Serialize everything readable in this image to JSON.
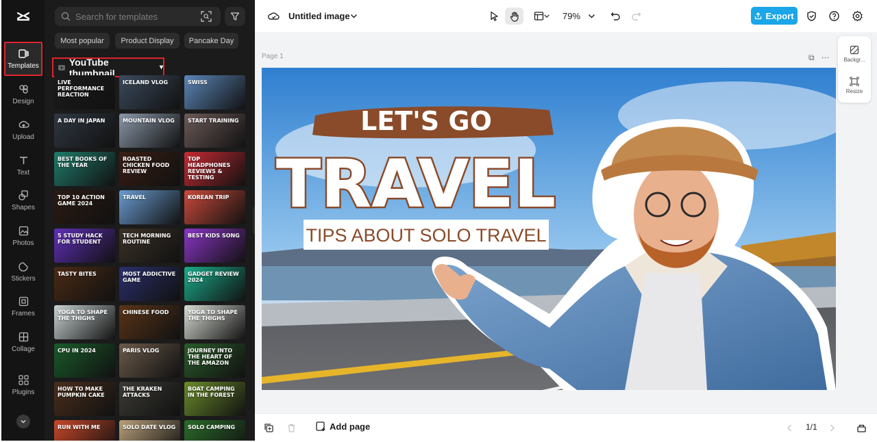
{
  "sidebar": {
    "items": [
      {
        "label": "Templates",
        "icon": "template-icon"
      },
      {
        "label": "Design",
        "icon": "design-icon"
      },
      {
        "label": "Upload",
        "icon": "upload-icon"
      },
      {
        "label": "Text",
        "icon": "text-icon"
      },
      {
        "label": "Shapes",
        "icon": "shapes-icon"
      },
      {
        "label": "Photos",
        "icon": "photos-icon"
      },
      {
        "label": "Stickers",
        "icon": "stickers-icon"
      },
      {
        "label": "Frames",
        "icon": "frames-icon"
      },
      {
        "label": "Collage",
        "icon": "collage-icon"
      },
      {
        "label": "Plugins",
        "icon": "plugins-icon"
      }
    ]
  },
  "panel": {
    "search_placeholder": "Search for templates",
    "chips": [
      "Most popular",
      "Product Display",
      "Pancake Day"
    ],
    "category": "YouTube thumbnail",
    "thumbnails": [
      {
        "text": "LIVE PERFORMANCE REACTION",
        "color": "#1b1b1b"
      },
      {
        "text": "Iceland Vlog",
        "color": "#3b4a5c"
      },
      {
        "text": "SWISS",
        "color": "#5b86b8"
      },
      {
        "text": "A DAY IN JAPAN",
        "color": "#2f3742"
      },
      {
        "text": "MOUNTAIN VLOG",
        "color": "#8a97a8"
      },
      {
        "text": "START TRAINING",
        "color": "#6b5a58"
      },
      {
        "text": "BEST BOOKS of the year",
        "color": "#1f7b6b"
      },
      {
        "text": "ROASTED CHICKEN FOOD REVIEW",
        "color": "#3a1e14"
      },
      {
        "text": "TOP HEADPHONES REVIEWS & TESTING",
        "color": "#c62b33"
      },
      {
        "text": "TOP 10 ACTION GAME 2024",
        "color": "#2b1a12"
      },
      {
        "text": "TRAVEL",
        "color": "#6a9bd0"
      },
      {
        "text": "KOREAN TRIP",
        "color": "#c94a3b"
      },
      {
        "text": "5 STUDY HACK FOR STUDENT",
        "color": "#5f2fb8"
      },
      {
        "text": "Tech Morning Routine",
        "color": "#3b3127"
      },
      {
        "text": "BEST KIDS SONG",
        "color": "#8a35c4"
      },
      {
        "text": "TASTY BITES",
        "color": "#4a2a14"
      },
      {
        "text": "MOST ADDICTIVE GAME",
        "color": "#2a2f6b"
      },
      {
        "text": "GADGET REVIEW 2024",
        "color": "#1bab8b"
      },
      {
        "text": "YOGA TO SHAPE THE THIGHS",
        "color": "#c9d2d2"
      },
      {
        "text": "CHINESE FOOD",
        "color": "#5a3418"
      },
      {
        "text": "YOGA TO SHAPE THE THIGHS",
        "color": "#d8dcd4"
      },
      {
        "text": "CPU IN 2024",
        "color": "#1a5a2a"
      },
      {
        "text": "Paris Vlog",
        "color": "#6b5a4a"
      },
      {
        "text": "JOURNEY INTO THE HEART OF THE AMAZON",
        "color": "#2a5a2a"
      },
      {
        "text": "HOW TO MAKE PUMPKIN CAKE",
        "color": "#4a2e1c"
      },
      {
        "text": "THE KRAKEN ATTACKS",
        "color": "#3b3a34"
      },
      {
        "text": "BOAT CAMPING IN THE FOREST",
        "color": "#6a8b2a"
      },
      {
        "text": "RUN WITH ME",
        "color": "#c9472a"
      },
      {
        "text": "Solo Date Vlog",
        "color": "#b8a07a"
      },
      {
        "text": "SOLO CAMPING",
        "color": "#2a6b2a"
      }
    ]
  },
  "topbar": {
    "title": "Untitled image",
    "zoom": "79%",
    "export_label": "Export"
  },
  "canvas": {
    "page_label": "Page 1",
    "headline_top": "LET'S GO",
    "headline_main": "TRAVEL",
    "subline": "TIPS ABOUT SOLO TRAVEL"
  },
  "side_tools": {
    "background_label": "Backgr...",
    "resize_label": "Resize"
  },
  "bottombar": {
    "add_page_label": "Add page",
    "pager": "1/1"
  },
  "colors": {
    "accent": "#1aa6e8",
    "highlight": "#e0242b",
    "brown": "#8a4b2a"
  }
}
